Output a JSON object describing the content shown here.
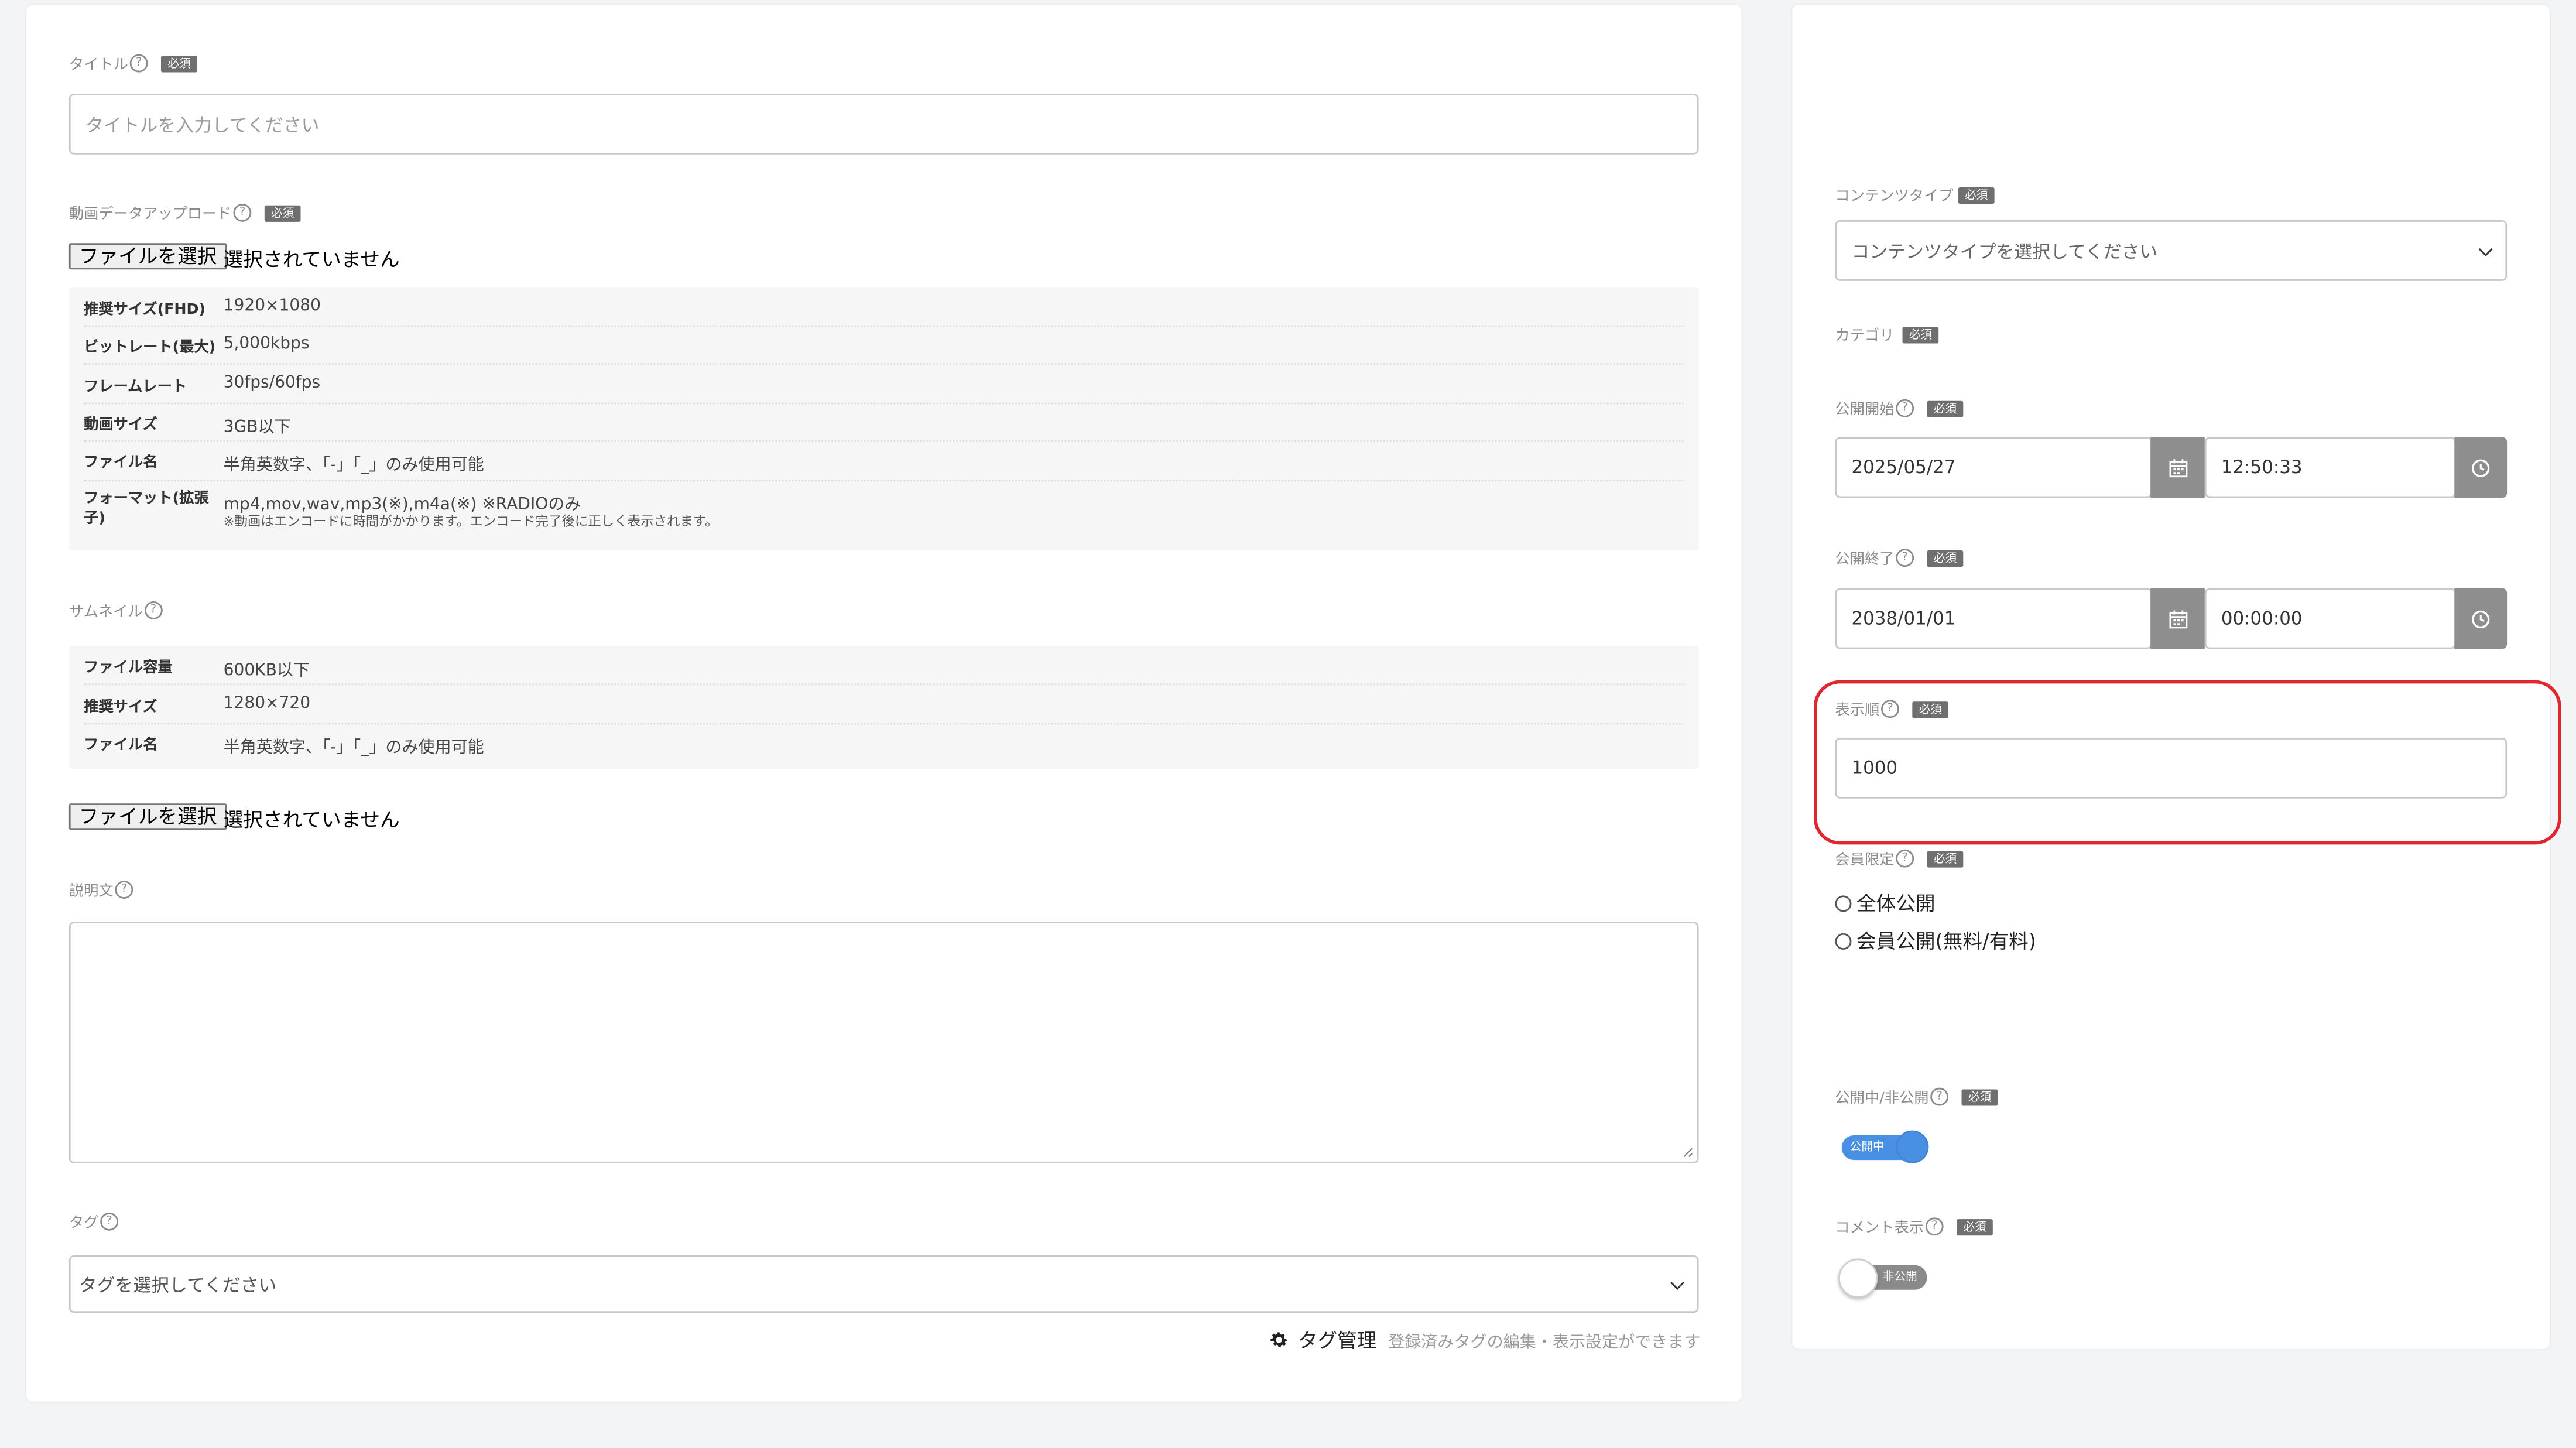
{
  "left": {
    "title": {
      "label": "タイトル",
      "required": "必須",
      "placeholder": "タイトルを入力してください"
    },
    "video_upload": {
      "label": "動画データアップロード",
      "required": "必須",
      "file_button": "ファイルを選択",
      "file_status": "選択されていません",
      "specs": [
        {
          "key": "推奨サイズ(FHD)",
          "value": "1920×1080"
        },
        {
          "key": "ビットレート(最大)",
          "value": "5,000kbps"
        },
        {
          "key": "フレームレート",
          "value": "30fps/60fps"
        },
        {
          "key": "動画サイズ",
          "value": "3GB以下"
        },
        {
          "key": "ファイル名",
          "value": "半角英数字、「-」「_」のみ使用可能"
        },
        {
          "key": "フォーマット(拡張子)",
          "value": "mp4,mov,wav,mp3(※),m4a(※) ※RADIOのみ",
          "note": "※動画はエンコードに時間がかかります。エンコード完了後に正しく表示されます。"
        }
      ]
    },
    "thumbnail": {
      "label": "サムネイル",
      "specs": [
        {
          "key": "ファイル容量",
          "value": "600KB以下"
        },
        {
          "key": "推奨サイズ",
          "value": "1280×720"
        },
        {
          "key": "ファイル名",
          "value": "半角英数字、「-」「_」のみ使用可能"
        }
      ],
      "file_button": "ファイルを選択",
      "file_status": "選択されていません"
    },
    "description": {
      "label": "説明文",
      "value": ""
    },
    "tags": {
      "label": "タグ",
      "placeholder": "タグを選択してください",
      "manage_label": "タグ管理",
      "manage_note": "登録済みタグの編集・表示設定ができます",
      "manage_icon": "gear-icon"
    }
  },
  "right": {
    "content_type": {
      "label": "コンテンツタイプ",
      "required": "必須",
      "placeholder": "コンテンツタイプを選択してください"
    },
    "category": {
      "label": "カテゴリ",
      "required": "必須"
    },
    "publish_start": {
      "label": "公開開始",
      "required": "必須",
      "date": "2025/05/27",
      "time": "12:50:33"
    },
    "publish_end": {
      "label": "公開終了",
      "required": "必須",
      "date": "2038/01/01",
      "time": "00:00:00"
    },
    "display_order": {
      "label": "表示順",
      "required": "必須",
      "value": "1000"
    },
    "membership": {
      "label": "会員限定",
      "required": "必須",
      "options": [
        "全体公開",
        "会員公開(無料/有料)"
      ]
    },
    "publish_state": {
      "label": "公開中/非公開",
      "required": "必須",
      "toggle_text": "公開中",
      "on": true
    },
    "comment_display": {
      "label": "コメント表示",
      "required": "必須",
      "toggle_text": "非公開",
      "on": false
    }
  },
  "colors": {
    "highlight": "#e0262f",
    "toggle_on": "#4a90e2",
    "addon": "#8e8e8e",
    "required_badge": "#6f6f6f"
  }
}
